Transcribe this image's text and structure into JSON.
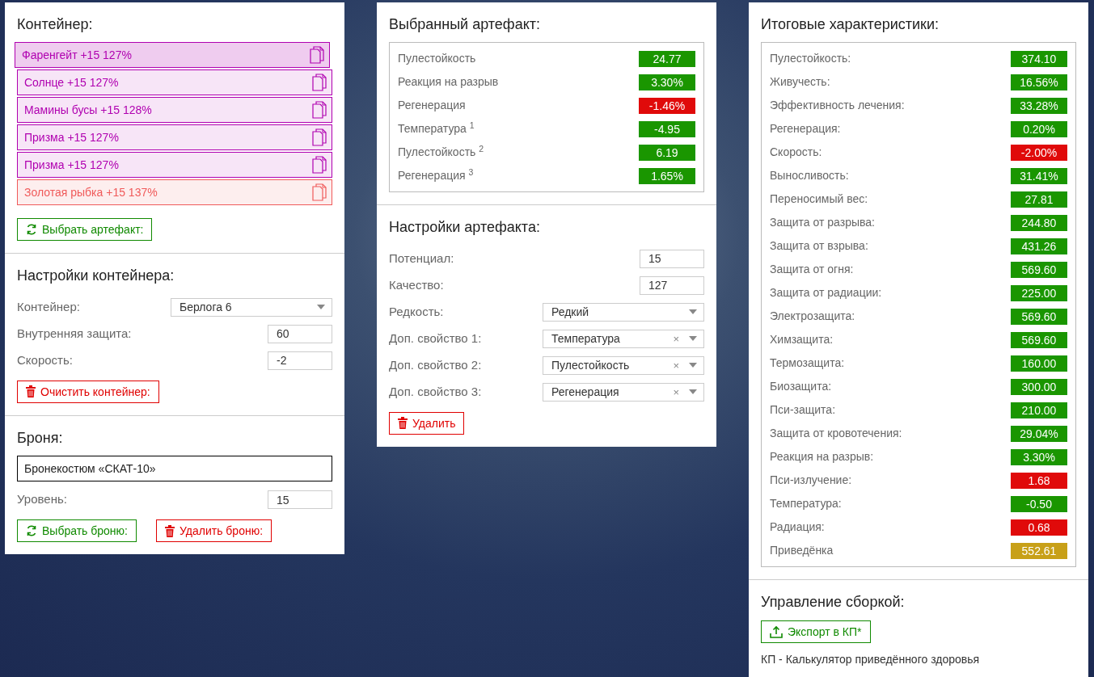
{
  "container": {
    "title": "Контейнер:",
    "artifacts": [
      {
        "label": "Фаренгейт +15 127%",
        "color": "#b000b0",
        "selected": true
      },
      {
        "label": "Солнце +15 127%",
        "color": "#b000b0",
        "selected": false
      },
      {
        "label": "Мамины бусы +15 128%",
        "color": "#b000b0",
        "selected": false
      },
      {
        "label": "Призма +15 127%",
        "color": "#b000b0",
        "selected": false
      },
      {
        "label": "Призма +15 127%",
        "color": "#b000b0",
        "selected": false
      },
      {
        "label": "Золотая рыбка +15 137%",
        "color": "#f05a5a",
        "selected": false
      }
    ],
    "button": {
      "label": "Выбрать артефакт:",
      "kind": "select"
    }
  },
  "container_settings": {
    "title": "Настройки контейнера:",
    "fields": [
      {
        "kind": "select",
        "label": "Контейнер:",
        "value": "Берлога 6"
      },
      {
        "kind": "input",
        "label": "Внутренняя защита:",
        "value": "60"
      },
      {
        "kind": "input",
        "label": "Скорость:",
        "value": "-2"
      }
    ],
    "button": {
      "label": "Очистить контейнер:",
      "kind": "delete"
    }
  },
  "armor": {
    "title": "Броня:",
    "name": "Бронекостюм «СКАТ-10»",
    "fields": [
      {
        "kind": "input",
        "label": "Уровень:",
        "value": "15"
      }
    ],
    "buttons": [
      {
        "label": "Выбрать броню:",
        "kind": "select"
      },
      {
        "label": "Удалить броню:",
        "kind": "delete"
      }
    ]
  },
  "selected_artifact": {
    "title": "Выбранный артефакт:",
    "stats": [
      {
        "label": "Пулестойкость",
        "value": "24.77",
        "color": "#1a9600"
      },
      {
        "label": "Реакция на разрыв",
        "value": "3.30%",
        "color": "#1a9600"
      },
      {
        "label": "Регенерация",
        "value": "-1.46%",
        "color": "#e00a0a"
      },
      {
        "label": "Температура $^{1}$",
        "value": "-4.95",
        "color": "#1a9600"
      },
      {
        "label": "Пулестойкость $^{2}$",
        "value": "6.19",
        "color": "#1a9600"
      },
      {
        "label": "Регенерация $^{3}$",
        "value": "1.65%",
        "color": "#1a9600"
      }
    ]
  },
  "artifact_settings": {
    "title": "Настройки артефакта:",
    "fields": [
      {
        "kind": "input",
        "label": "Потенциал:",
        "value": "15"
      },
      {
        "kind": "input",
        "label": "Качество:",
        "value": "127"
      },
      {
        "kind": "select",
        "label": "Редкость:",
        "value": "Редкий"
      },
      {
        "kind": "select",
        "label": "Доп. свойство 1:",
        "value": "Температура",
        "clear": "×"
      },
      {
        "kind": "select",
        "label": "Доп. свойство 2:",
        "value": "Пулестойкость",
        "clear": "×"
      },
      {
        "kind": "select",
        "label": "Доп. свойство 3:",
        "value": "Регенерация",
        "clear": "×"
      }
    ],
    "button": {
      "label": "Удалить",
      "kind": "delete"
    }
  },
  "totals": {
    "title": "Итоговые характеристики:",
    "stats": [
      {
        "label": "Пулестойкость:",
        "value": "374.10",
        "color": "#1a9600"
      },
      {
        "label": "Живучесть:",
        "value": "16.56%",
        "color": "#1a9600"
      },
      {
        "label": "Эффективность лечения:",
        "value": "33.28%",
        "color": "#1a9600"
      },
      {
        "label": "Регенерация:",
        "value": "0.20%",
        "color": "#1a9600"
      },
      {
        "label": "Скорость:",
        "value": "-2.00%",
        "color": "#e00a0a"
      },
      {
        "label": "Выносливость:",
        "value": "31.41%",
        "color": "#1a9600"
      },
      {
        "label": "Переносимый вес:",
        "value": "27.81",
        "color": "#1a9600"
      },
      {
        "label": "Защита от разрыва:",
        "value": "244.80",
        "color": "#1a9600"
      },
      {
        "label": "Защита от взрыва:",
        "value": "431.26",
        "color": "#1a9600"
      },
      {
        "label": "Защита от огня:",
        "value": "569.60",
        "color": "#1a9600"
      },
      {
        "label": "Защита от радиации:",
        "value": "225.00",
        "color": "#1a9600"
      },
      {
        "label": "Электрозащита:",
        "value": "569.60",
        "color": "#1a9600"
      },
      {
        "label": "Химзащита:",
        "value": "569.60",
        "color": "#1a9600"
      },
      {
        "label": "Термозащита:",
        "value": "160.00",
        "color": "#1a9600"
      },
      {
        "label": "Биозащита:",
        "value": "300.00",
        "color": "#1a9600"
      },
      {
        "label": "Пси-защита:",
        "value": "210.00",
        "color": "#1a9600"
      },
      {
        "label": "Защита от кровотечения:",
        "value": "29.04%",
        "color": "#1a9600"
      },
      {
        "label": "Реакция на разрыв:",
        "value": "3.30%",
        "color": "#1a9600"
      },
      {
        "label": "Пси-излучение:",
        "value": "1.68",
        "color": "#e00a0a"
      },
      {
        "label": "Температура:",
        "value": "-0.50",
        "color": "#1a9600"
      },
      {
        "label": "Радиация:",
        "value": "0.68",
        "color": "#e00a0a"
      },
      {
        "label": "Приведёнка",
        "value": "552.61",
        "color": "#c8a018"
      }
    ]
  },
  "build": {
    "title": "Управление сборкой:",
    "button": {
      "label": "Экспорт в КП*",
      "kind": "export"
    },
    "note": "КП - Калькулятор приведённого здоровья"
  }
}
